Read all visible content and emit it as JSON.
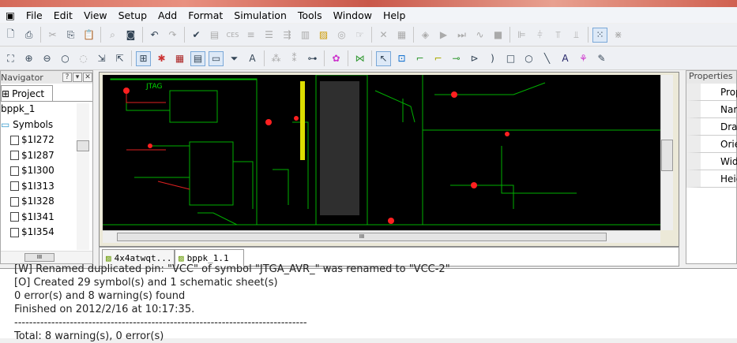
{
  "menu": [
    "File",
    "Edit",
    "View",
    "Setup",
    "Add",
    "Format",
    "Simulation",
    "Tools",
    "Window",
    "Help"
  ],
  "navigator": {
    "title": "Navigator",
    "tab": "Project",
    "root": "bppk_1",
    "folder": "Symbols",
    "items": [
      "$1I272",
      "$1I287",
      "$1I300",
      "$1I313",
      "$1I328",
      "$1I341",
      "$1I354"
    ]
  },
  "tabs": [
    "4x4atwqt...",
    "bppk_1.1"
  ],
  "properties": {
    "title": "Properties",
    "rows": [
      "Prop",
      "Nam",
      "Drav",
      "Orier",
      "Widt",
      "Heig"
    ]
  },
  "schematic": {
    "label": "JTAG"
  },
  "output": [
    "[W] Renamed duplicated pin: \"VCC\" of symbol \"JTGA_AVR_\" was renamed to \"VCC-2\"",
    "[O] Created 29 symbol(s) and 1 schematic sheet(s)",
    "0 error(s) and 8 warning(s) found",
    "Finished on 2012/2/16 at 10:17:35.",
    "-------------------------------------------------------------------------------",
    "Total: 8 warning(s), 0 error(s)"
  ],
  "colors": {
    "wire": "#00c000",
    "node": "#ff2020",
    "canvas": "#000000"
  }
}
